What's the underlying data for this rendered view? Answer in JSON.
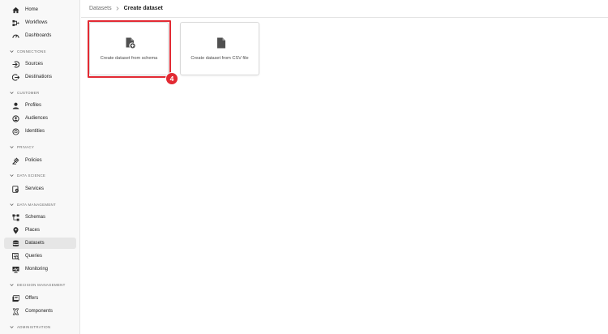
{
  "sidebar": {
    "top_items": [
      {
        "label": "Home",
        "icon": "home-icon"
      },
      {
        "label": "Workflows",
        "icon": "workflows-icon"
      },
      {
        "label": "Dashboards",
        "icon": "dashboards-icon"
      }
    ],
    "sections": [
      {
        "title": "CONNECTIONS",
        "items": [
          {
            "label": "Sources",
            "icon": "sources-icon"
          },
          {
            "label": "Destinations",
            "icon": "destinations-icon"
          }
        ]
      },
      {
        "title": "CUSTOMER",
        "items": [
          {
            "label": "Profiles",
            "icon": "profiles-icon"
          },
          {
            "label": "Audiences",
            "icon": "audiences-icon"
          },
          {
            "label": "Identities",
            "icon": "identities-icon"
          }
        ]
      },
      {
        "title": "PRIVACY",
        "items": [
          {
            "label": "Policies",
            "icon": "policies-icon"
          }
        ]
      },
      {
        "title": "DATA SCIENCE",
        "items": [
          {
            "label": "Services",
            "icon": "services-icon"
          }
        ]
      },
      {
        "title": "DATA MANAGEMENT",
        "items": [
          {
            "label": "Schemas",
            "icon": "schemas-icon"
          },
          {
            "label": "Places",
            "icon": "places-icon"
          },
          {
            "label": "Datasets",
            "icon": "datasets-icon",
            "selected": true
          },
          {
            "label": "Queries",
            "icon": "queries-icon"
          },
          {
            "label": "Monitoring",
            "icon": "monitoring-icon"
          }
        ]
      },
      {
        "title": "DECISION MANAGEMENT",
        "items": [
          {
            "label": "Offers",
            "icon": "offers-icon"
          },
          {
            "label": "Components",
            "icon": "components-icon"
          }
        ]
      },
      {
        "title": "ADMINISTRATION",
        "items": []
      }
    ]
  },
  "breadcrumb": {
    "parent": "Datasets",
    "current": "Create dataset"
  },
  "cards": [
    {
      "label": "Create dataset from schema",
      "icon": "file-add-icon"
    },
    {
      "label": "Create dataset from CSV file",
      "icon": "file-icon"
    }
  ],
  "callout": {
    "number": "4",
    "color": "#e22a33"
  },
  "colors": {
    "sidebar_bg": "#f8f8f8",
    "selected_bg": "#e6e6e6",
    "highlight": "#e22a33"
  }
}
